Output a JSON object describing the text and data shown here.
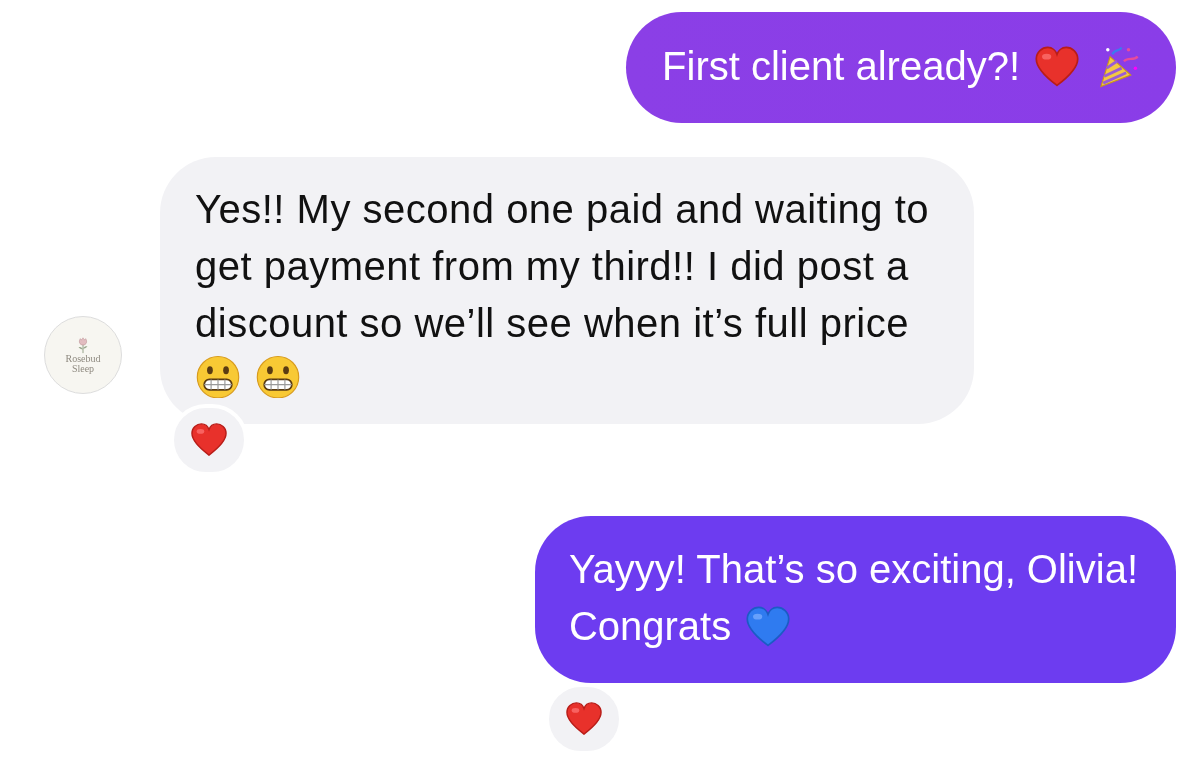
{
  "messages": [
    {
      "kind": "outgoing",
      "lines": [
        "First client already?!"
      ],
      "icons": [
        {
          "kind": "red-heart"
        },
        {
          "kind": "party-popper"
        }
      ],
      "icon_row": false
    },
    {
      "kind": "incoming",
      "avatar": {
        "logo_text": "Rosebud Sleep"
      },
      "lines": [
        "Yes!! My second one paid and waiting to",
        "get payment from my third!! I did post a",
        "discount so we’ll see when it’s full price"
      ],
      "icons": [
        {
          "kind": "grimace"
        },
        {
          "kind": "grimace"
        }
      ],
      "icon_row": true,
      "reaction": {
        "kind": "red-heart"
      }
    },
    {
      "kind": "outgoing",
      "lines": [
        "Yayyy! That’s so exciting, Olivia!",
        "Congrats"
      ],
      "icons": [
        {
          "kind": "blue-heart"
        }
      ],
      "icon_row": false,
      "reaction": {
        "kind": "red-heart"
      }
    }
  ]
}
